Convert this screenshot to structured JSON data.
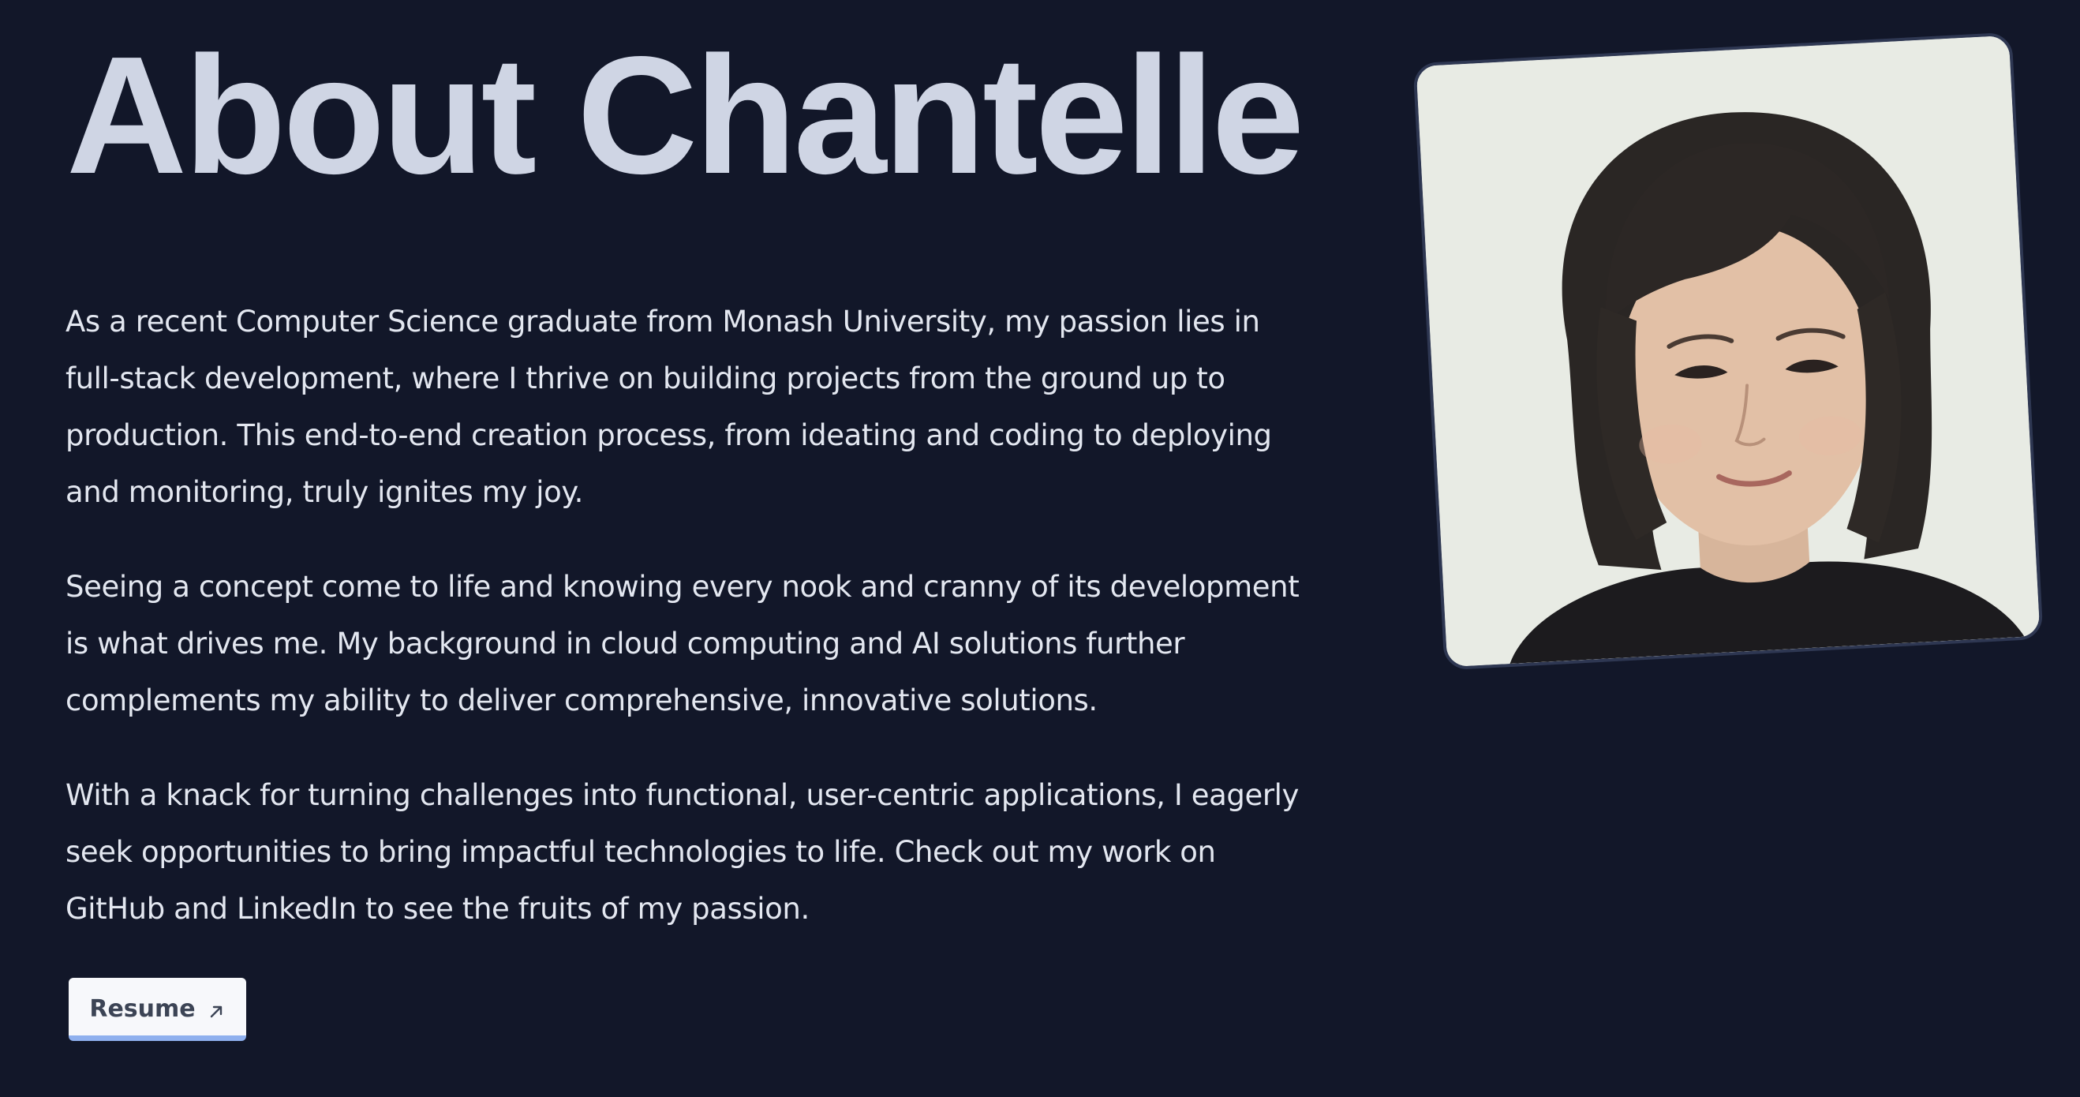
{
  "about": {
    "title": "About Chantelle",
    "paragraphs": [
      "As a recent Computer Science graduate from Monash University, my passion lies in full-stack development, where I thrive on building projects from the ground up to production. This end-to-end creation process, from ideating and coding to deploying and monitoring, truly ignites my joy.",
      "Seeing a concept come to life and knowing every nook and cranny of its development is what drives me. My background in cloud computing and AI solutions further complements my ability to deliver comprehensive, innovative solutions.",
      "With a knack for turning challenges into functional, user-centric applications, I eagerly seek opportunities to bring impactful technologies to life. Check out my work on GitHub and LinkedIn to see the fruits of my passion."
    ],
    "resume_button": {
      "label": "Resume",
      "icon": "arrow-up-right-icon"
    }
  },
  "photo": {
    "alt": "Portrait of Chantelle",
    "icon": "profile-photo"
  },
  "colors": {
    "background": "#121729",
    "title": "#cfd5e4",
    "text": "#e3e7f0",
    "button_bg": "#f7f8fb",
    "button_accent": "#8fb0ee"
  }
}
